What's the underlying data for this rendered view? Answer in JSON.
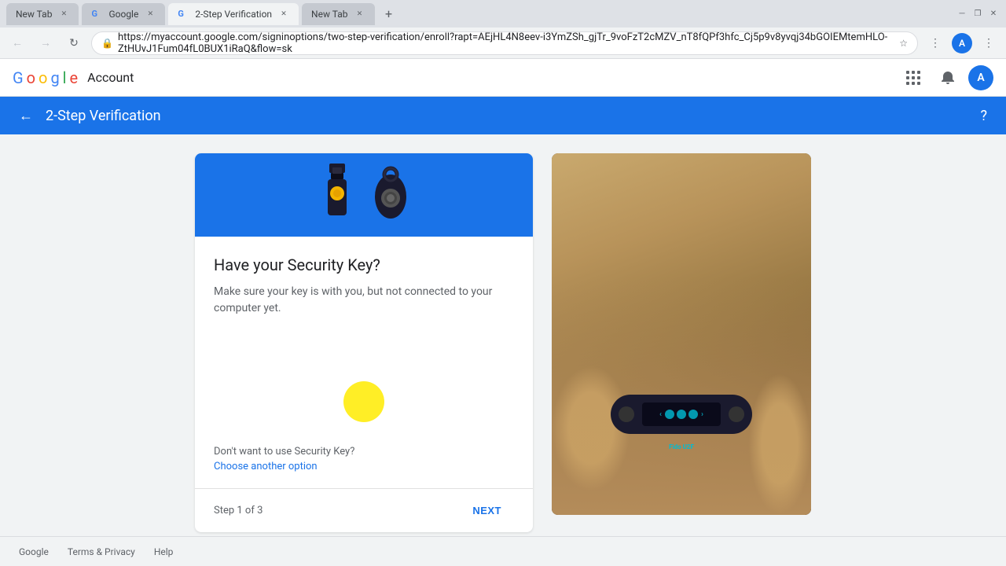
{
  "browser": {
    "tabs": [
      {
        "id": "new-tab-1",
        "title": "New Tab",
        "active": false,
        "favicon": ""
      },
      {
        "id": "google-tab",
        "title": "Google",
        "active": false,
        "favicon": "G"
      },
      {
        "id": "2step-tab",
        "title": "2-Step Verification",
        "active": true,
        "favicon": "G"
      },
      {
        "id": "new-tab-2",
        "title": "New Tab",
        "active": false,
        "favicon": ""
      }
    ],
    "address": "https://myaccount.google.com/signinoptions/two-step-verification/enroll?rapt=AEjHL4N8eev-i3YmZSh_gjTr_9voFzT2cMZV_nT8fQPf3hfc_Cj5p9v8yvqj34bGOIEMtemHLO-ZtHUvJ1Fum04fL0BUX1iRaQ&flow=sk",
    "window_controls": [
      "minimize",
      "restore",
      "close"
    ]
  },
  "google_header": {
    "logo_text": "Google",
    "account_text": "Account",
    "apps_icon": "⋮⋮⋮",
    "profile_letter": "A"
  },
  "banner": {
    "back_arrow": "←",
    "title": "2-Step Verification",
    "help_icon": "?"
  },
  "card": {
    "title": "Have your Security Key?",
    "subtitle": "Make sure your key is with you, but not connected to your computer yet.",
    "dont_want_text": "Don't want to use Security Key?",
    "choose_link_text": "Choose another option",
    "step_text": "Step 1 of 3",
    "next_button": "NEXT"
  },
  "footer": {
    "links": [
      "Google",
      "Terms & Privacy",
      "Help"
    ]
  }
}
